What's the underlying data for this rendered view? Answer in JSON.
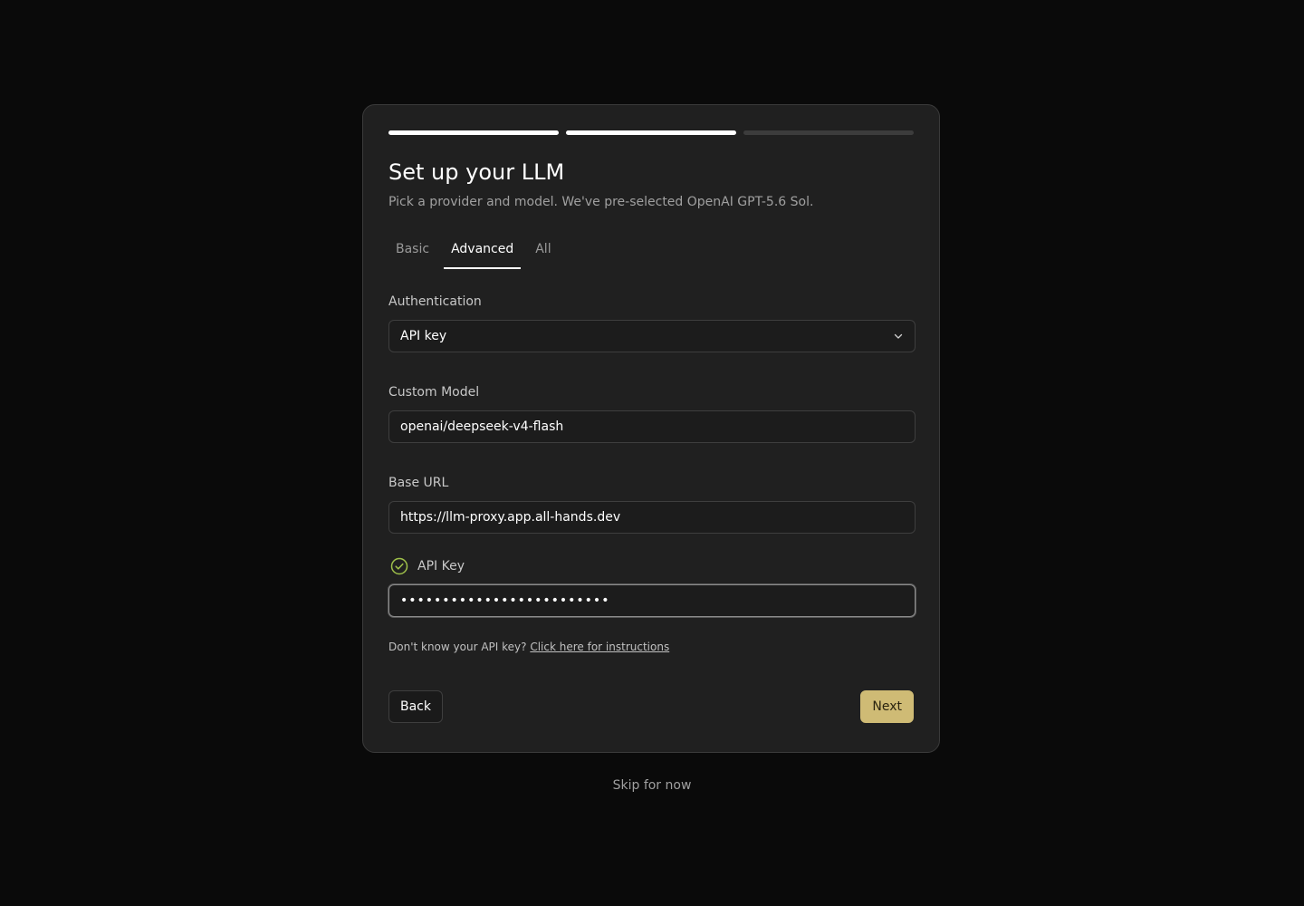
{
  "progress": {
    "total_steps": 3,
    "completed_steps": 2
  },
  "header": {
    "title": "Set up your LLM",
    "subtitle": "Pick a provider and model. We've pre-selected OpenAI GPT-5.6 Sol."
  },
  "tabs": [
    {
      "label": "Basic",
      "active": false
    },
    {
      "label": "Advanced",
      "active": true
    },
    {
      "label": "All",
      "active": false
    }
  ],
  "form": {
    "authentication": {
      "label": "Authentication",
      "value": "API key",
      "icon": "chevron-down-icon"
    },
    "custom_model": {
      "label": "Custom Model",
      "value": "openai/deepseek-v4-flash"
    },
    "base_url": {
      "label": "Base URL",
      "value": "https://llm-proxy.app.all-hands.dev"
    },
    "api_key": {
      "label": "API Key",
      "value": "•••••••••••••••••••••••••",
      "status_icon": "check-circle-icon",
      "status_color": "#9fc04a"
    }
  },
  "help": {
    "text": "Don't know your API key?",
    "link": "Click here for instructions"
  },
  "actions": {
    "back_label": "Back",
    "next_label": "Next",
    "next_color": "#cfbb75"
  },
  "footer": {
    "skip_label": "Skip for now"
  }
}
